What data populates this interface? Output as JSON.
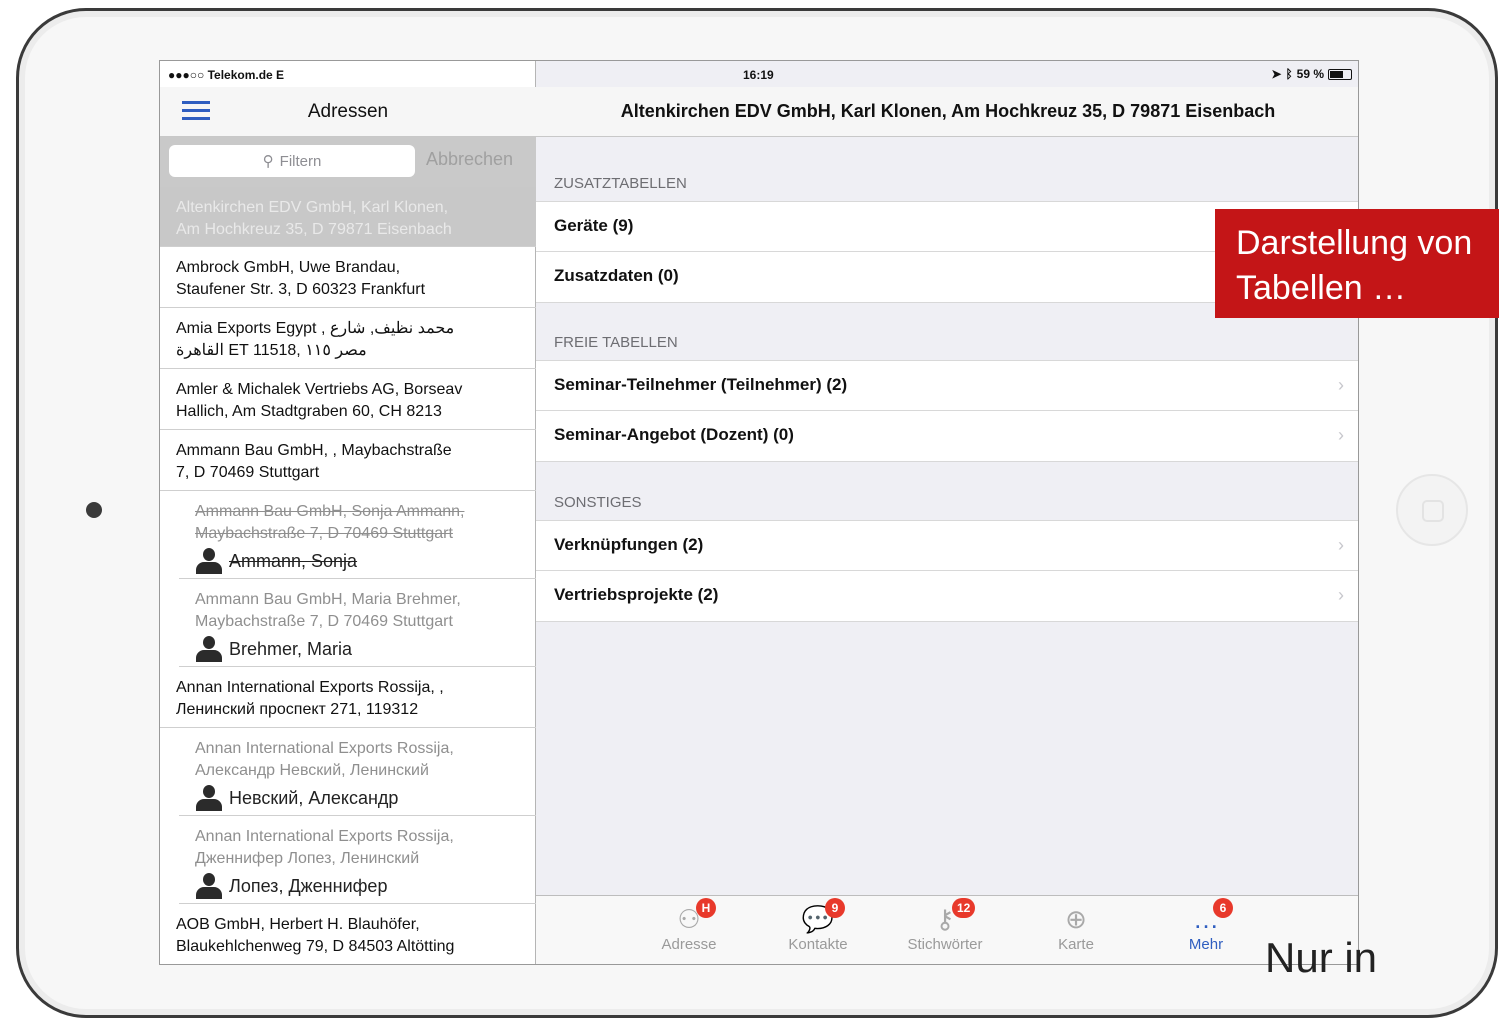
{
  "status": {
    "carrier": "●●●○○ Telekom.de  E",
    "time": "16:19",
    "battery": "59 %"
  },
  "left": {
    "title": "Adressen",
    "filter_placeholder": "Filtern",
    "cancel": "Abbrechen",
    "items": [
      {
        "line1": "Altenkirchen EDV GmbH, Karl Klonen,",
        "line2": "Am Hochkreuz 35, D 79871 Eisenbach"
      },
      {
        "line1": "Ambrock GmbH, Uwe Brandau,",
        "line2": "Staufener Str. 3, D 60323 Frankfurt"
      },
      {
        "line1": "Amia Exports Egypt , محمد نظيف, شارع",
        "line2": "القاهرة ET 11518, مصر ١١٥"
      },
      {
        "line1": "Amler & Michalek Vertriebs AG, Borseav",
        "line2": "Hallich, Am Stadtgraben 60, CH 8213"
      },
      {
        "line1": "Ammann Bau GmbH,  , Maybachstraße",
        "line2": "7, D 70469 Stuttgart"
      }
    ],
    "contacts": [
      {
        "line1": "Ammann Bau GmbH, Sonja Ammann,",
        "line2": "Maybachstraße 7, D 70469 Stuttgart",
        "name": "Ammann, Sonja"
      },
      {
        "line1": "Ammann Bau GmbH, Maria Brehmer,",
        "line2": "Maybachstraße 7, D 70469 Stuttgart",
        "name": "Brehmer, Maria"
      }
    ],
    "annan": {
      "line1": "Annan International Exports Rossija,  ,",
      "line2": "Ленинский проспект 271,  119312"
    },
    "contacts2": [
      {
        "line1": "Annan International Exports Rossija,",
        "line2": "Александр Невский, Ленинский",
        "name": "Невский, Александр"
      },
      {
        "line1": "Annan International Exports Rossija,",
        "line2": "Дженнифер Лопез, Ленинский",
        "name": "Лопез, Дженнифер"
      }
    ],
    "aob": {
      "line1": "AOB GmbH, Herbert H. Blauhöfer,",
      "line2": "Blaukehlchenweg 79, D 84503 Altötting"
    }
  },
  "right": {
    "title": "Altenkirchen EDV GmbH, Karl Klonen, Am Hochkreuz 35, D 79871 Eisenbach",
    "sections": [
      {
        "header": "ZUSATZTABELLEN",
        "rows": [
          "Geräte (9)",
          "Zusatzdaten (0)"
        ]
      },
      {
        "header": "FREIE TABELLEN",
        "rows": [
          "Seminar-Teilnehmer (Teilnehmer) (2)",
          "Seminar-Angebot (Dozent) (0)"
        ]
      },
      {
        "header": "SONSTIGES",
        "rows": [
          "Verknüpfungen (2)",
          "Vertriebsprojekte (2)"
        ]
      }
    ],
    "tabs": [
      {
        "label": "Adresse",
        "badge": "H",
        "icon": "people-icon"
      },
      {
        "label": "Kontakte",
        "badge": "9",
        "icon": "chat-icon"
      },
      {
        "label": "Stichwörter",
        "badge": "12",
        "icon": "key-icon"
      },
      {
        "label": "Karte",
        "badge": "",
        "icon": "globe-icon"
      },
      {
        "label": "Mehr",
        "badge": "6",
        "icon": "more-icon"
      }
    ]
  },
  "overlay": {
    "line1": "Darstellung von",
    "line2": "Tabellen …"
  },
  "footnote": "Nur in",
  "colors": {
    "accent": "#2f5ec0",
    "badge": "#e8392b",
    "overlay": "#c41517"
  }
}
